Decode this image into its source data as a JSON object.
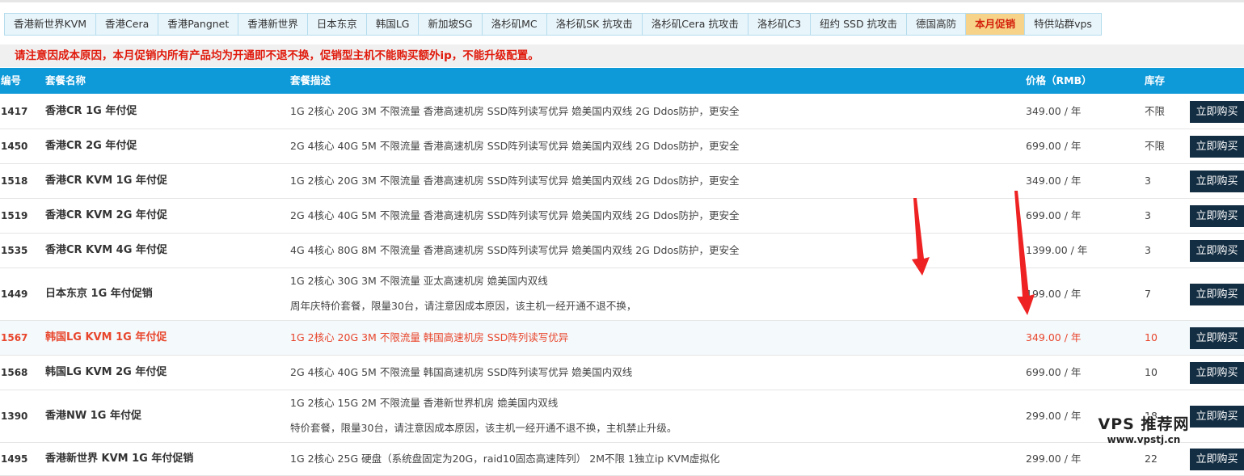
{
  "tabs": [
    {
      "label": "香港新世界KVM",
      "active": false
    },
    {
      "label": "香港Cera",
      "active": false
    },
    {
      "label": "香港Pangnet",
      "active": false
    },
    {
      "label": "香港新世界",
      "active": false
    },
    {
      "label": "日本东京",
      "active": false
    },
    {
      "label": "韩国LG",
      "active": false
    },
    {
      "label": "新加坡SG",
      "active": false
    },
    {
      "label": "洛杉矶MC",
      "active": false
    },
    {
      "label": "洛杉矶SK 抗攻击",
      "active": false
    },
    {
      "label": "洛杉矶Cera 抗攻击",
      "active": false
    },
    {
      "label": "洛杉矶C3",
      "active": false
    },
    {
      "label": "纽约 SSD 抗攻击",
      "active": false
    },
    {
      "label": "德国高防",
      "active": false
    },
    {
      "label": "本月促销",
      "active": true
    },
    {
      "label": "特供站群vps",
      "active": false
    }
  ],
  "notice": "请注意因成本原因，本月促销内所有产品均为开通即不退不换，促销型主机不能购买额外ip，不能升级配置。",
  "table": {
    "headers": {
      "id": "编号",
      "name": "套餐名称",
      "desc": "套餐描述",
      "price": "价格（RMB）",
      "stock": "库存"
    },
    "rows": [
      {
        "id": "1417",
        "name": "香港CR 1G 年付促",
        "desc": [
          "1G 2核心 20G 3M 不限流量 香港高速机房 SSD阵列读写优异 嫓美国内双线 2G Ddos防护，更安全"
        ],
        "price": "349.00 / 年",
        "stock": "不限",
        "buy": "立即购买"
      },
      {
        "id": "1450",
        "name": "香港CR 2G 年付促",
        "desc": [
          "2G 4核心 40G 5M 不限流量 香港高速机房 SSD阵列读写优异 嫓美国内双线 2G Ddos防护，更安全"
        ],
        "price": "699.00 / 年",
        "stock": "不限",
        "buy": "立即购买"
      },
      {
        "id": "1518",
        "name": "香港CR KVM 1G 年付促",
        "desc": [
          "1G 2核心 20G 3M 不限流量 香港高速机房 SSD阵列读写优异 嫓美国内双线 2G Ddos防护，更安全"
        ],
        "price": "349.00 / 年",
        "stock": "3",
        "buy": "立即购买"
      },
      {
        "id": "1519",
        "name": "香港CR KVM 2G 年付促",
        "desc": [
          "2G 4核心 40G 5M 不限流量 香港高速机房 SSD阵列读写优异 嫓美国内双线 2G Ddos防护，更安全"
        ],
        "price": "699.00 / 年",
        "stock": "3",
        "buy": "立即购买"
      },
      {
        "id": "1535",
        "name": "香港CR KVM 4G 年付促",
        "desc": [
          "4G 4核心 80G 8M 不限流量 香港高速机房 SSD阵列读写优异 嫓美国内双线 2G Ddos防护，更安全"
        ],
        "price": "1399.00 / 年",
        "stock": "3",
        "buy": "立即购买"
      },
      {
        "id": "1449",
        "name": "日本东京 1G 年付促销",
        "desc": [
          "1G 2核心 30G 3M 不限流量 亚太高速机房 嫓美国内双线",
          "周年庆特价套餐，限量30台，请注意因成本原因，该主机一经开通不退不换，"
        ],
        "price": "199.00 / 年",
        "stock": "7",
        "buy": "立即购买"
      },
      {
        "id": "1567",
        "name": "韩国LG KVM 1G 年付促",
        "desc": [
          "1G 2核心 20G 3M 不限流量 韩国高速机房 SSD阵列读写优异"
        ],
        "price": "349.00 / 年",
        "stock": "10",
        "buy": "立即购买",
        "highlight": true
      },
      {
        "id": "1568",
        "name": "韩国LG KVM 2G 年付促",
        "desc": [
          "2G 4核心 40G 5M 不限流量 韩国高速机房 SSD阵列读写优异 嫓美国内双线"
        ],
        "price": "699.00 / 年",
        "stock": "10",
        "buy": "立即购买"
      },
      {
        "id": "1390",
        "name": "香港NW 1G 年付促",
        "desc": [
          "1G 2核心 15G 2M 不限流量 香港新世界机房 嫓美国内双线",
          "特价套餐，限量30台，请注意因成本原因，该主机一经开通不退不换，主机禁止升级。"
        ],
        "price": "299.00 / 年",
        "stock": "18",
        "buy": "立即购买"
      },
      {
        "id": "1495",
        "name": "香港新世界 KVM 1G 年付促销",
        "desc": [
          "1G 2核心 25G 硬盘（系统盘固定为20G，raid10固态高速阵列） 2M不限 1独立ip KVM虚拟化"
        ],
        "price": "299.00 / 年",
        "stock": "22",
        "buy": "立即购买"
      }
    ]
  },
  "watermark": {
    "line1": "VPS 推荐网",
    "line2": "www.vpstj.cn"
  },
  "colors": {
    "header_bg": "#0e99d9",
    "buy_bg": "#132d42",
    "notice": "#e01a0c",
    "active_tab_bg": "#f6d389",
    "highlight_text": "#e8462c",
    "arrow": "#ee2222"
  }
}
